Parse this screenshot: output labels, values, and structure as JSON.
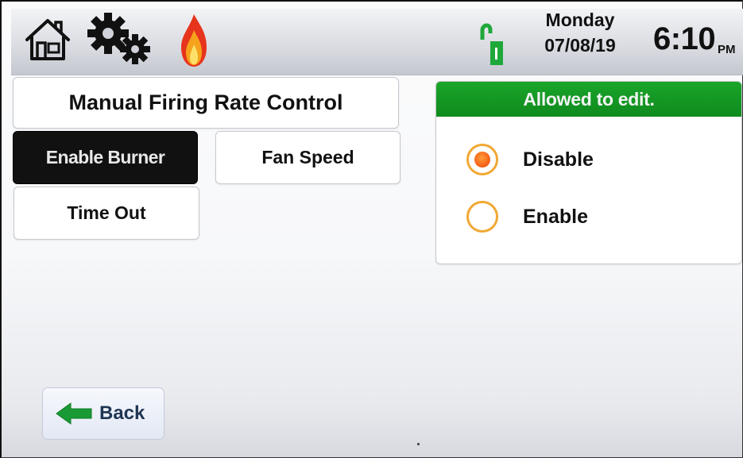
{
  "header": {
    "day": "Monday",
    "date": "07/08/19",
    "time": "6:10",
    "ampm": "PM",
    "icons": [
      "home-icon",
      "gears-icon",
      "flame-icon",
      "unlocked-lock-icon"
    ]
  },
  "page": {
    "title": "Manual Firing Rate Control"
  },
  "menu": {
    "enable_burner": "Enable Burner",
    "fan_speed": "Fan Speed",
    "time_out": "Time Out"
  },
  "edit_panel": {
    "header": "Allowed to edit.",
    "options": [
      {
        "label": "Disable",
        "selected": true
      },
      {
        "label": "Enable",
        "selected": false
      }
    ]
  },
  "footer": {
    "back_label": "Back"
  },
  "colors": {
    "header_green": "#12962a",
    "radio_orange": "#f1a833",
    "radio_dot": "#f35b16",
    "lock_green": "#1fa83a",
    "selected_button": "#111111"
  }
}
